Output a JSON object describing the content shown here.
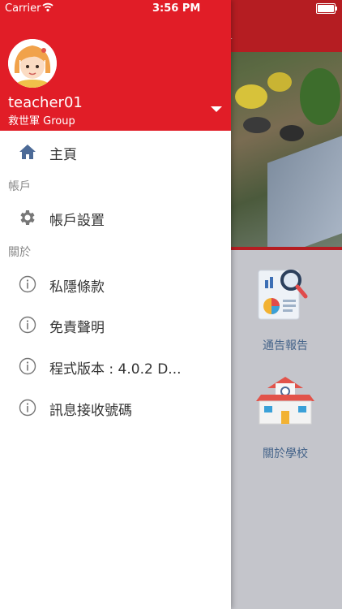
{
  "status_bar": {
    "carrier": "Carrier",
    "time": "3:56 PM"
  },
  "background": {
    "header_title": "告",
    "tiles": [
      {
        "label": "通告報告",
        "icon": "report-chart-icon"
      },
      {
        "label": "關於學校",
        "icon": "school-building-icon"
      }
    ]
  },
  "drawer": {
    "user": {
      "name": "teacher01",
      "group": "救世軍 Group"
    },
    "home": {
      "label": "主頁",
      "icon": "home-icon"
    },
    "sections": {
      "account": "帳戶",
      "about": "關於"
    },
    "account_items": [
      {
        "label": "帳戶設置",
        "icon": "gear-icon"
      }
    ],
    "about_items": [
      {
        "label": "私隱條款",
        "icon": "info-icon"
      },
      {
        "label": "免責聲明",
        "icon": "info-icon"
      },
      {
        "label": "程式版本 : 4.0.2 D...",
        "icon": "info-icon"
      },
      {
        "label": "訊息接收號碼",
        "icon": "info-icon"
      }
    ]
  },
  "colors": {
    "drawer_header": "#e11d27",
    "app_header": "#b51d22",
    "home_icon": "#4c6a97"
  }
}
